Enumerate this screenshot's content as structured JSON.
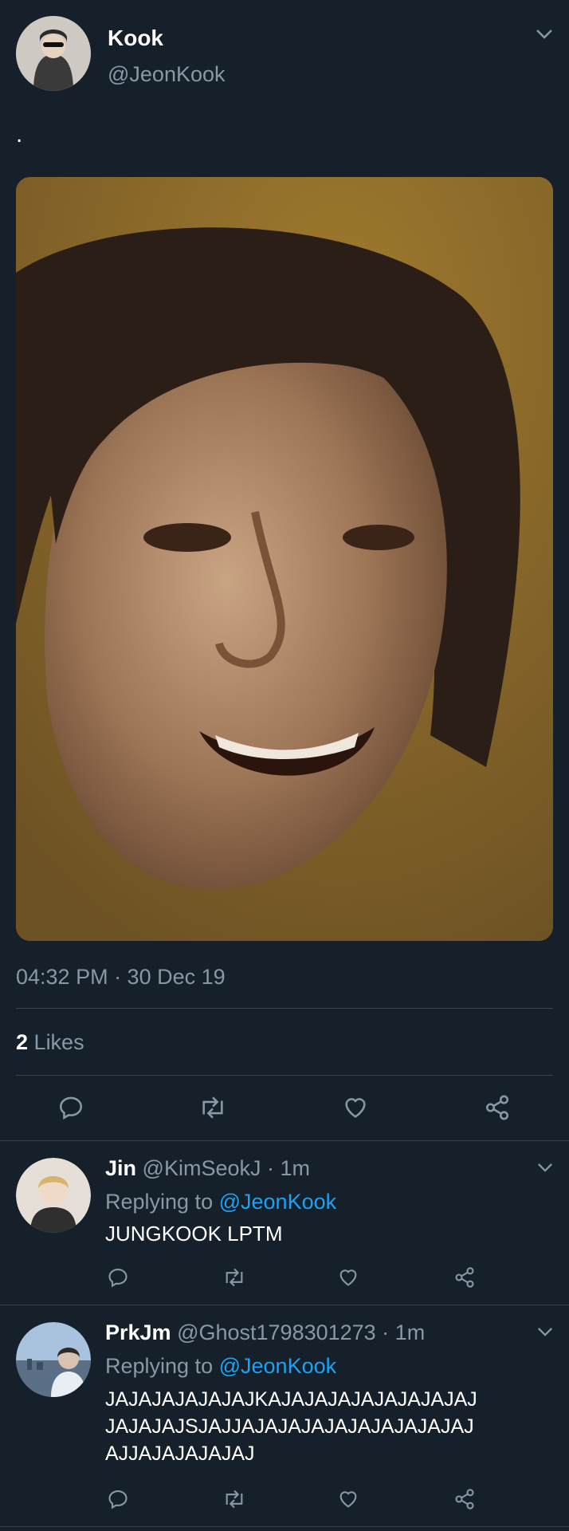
{
  "main_tweet": {
    "display_name": "Kook",
    "handle": "@JeonKook",
    "text": ".",
    "timestamp": "04:32 PM · 30 Dec 19",
    "likes_count": "2",
    "likes_label": "Likes",
    "avatar_icon": "avatar-icon",
    "actions": [
      "reply-icon",
      "retweet-icon",
      "like-icon",
      "share-icon"
    ]
  },
  "replies": [
    {
      "display_name": "Jin",
      "meta": "@KimSeokJ · 1m",
      "replying_prefix": "Replying to",
      "replying_to": "@JeonKook",
      "text": "JUNGKOOK LPTM"
    },
    {
      "display_name": "PrkJm",
      "meta": "@Ghost1798301273 · 1m",
      "replying_prefix": "Replying to",
      "replying_to": "@JeonKook",
      "text_lines": [
        "JAJAJAJAJAJAJKAJAJAJAJAJAJAJAJAJ",
        "JAJAJAJSJAJJAJAJAJAJAJAJAJAJAJAJ",
        "AJJAJAJAJAJAJ"
      ]
    }
  ],
  "colors": {
    "background": "#15202b",
    "divider": "#38444d",
    "muted": "#8899a6",
    "link": "#1da1f2"
  }
}
